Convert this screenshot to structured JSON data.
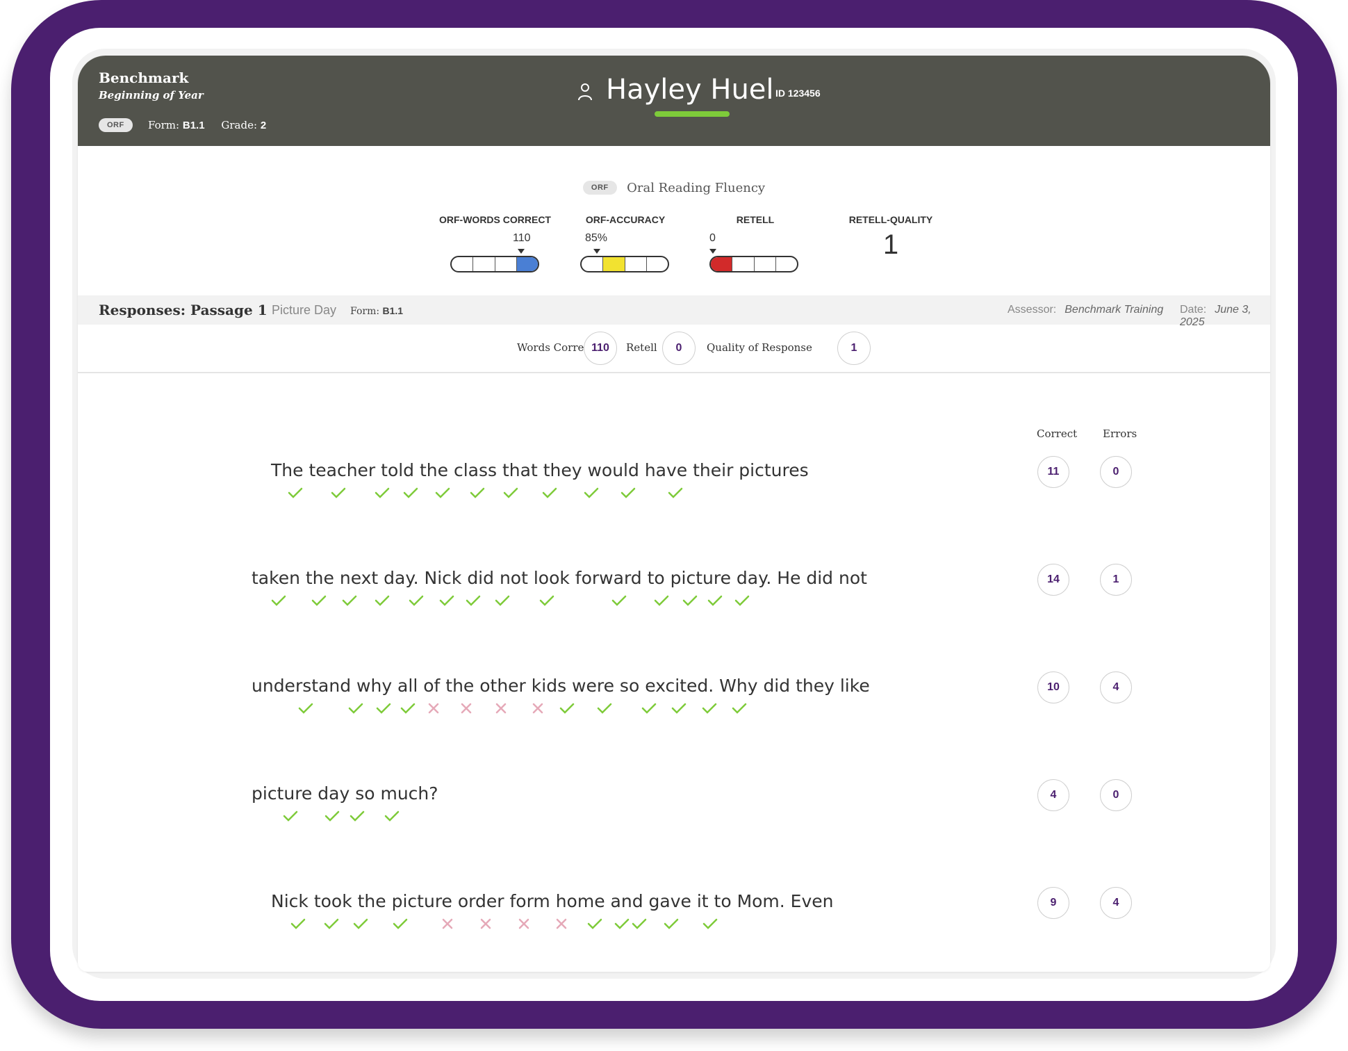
{
  "header": {
    "title": "Benchmark",
    "subtitle": "Beginning of Year",
    "badge": "ORF",
    "form_label": "Form:",
    "form_value": "B1.1",
    "grade_label": "Grade:",
    "grade_value": "2",
    "student_name": "Hayley Huel",
    "student_id": "ID 123456",
    "user_icon": "person-icon"
  },
  "scores": {
    "badge": "ORF",
    "title": "Oral Reading Fluency",
    "metrics": [
      {
        "label": "ORF-WORDS CORRECT",
        "value": "110",
        "level": 4,
        "color": "#4a7fd4"
      },
      {
        "label": "ORF-ACCURACY",
        "value": "85%",
        "level": 2,
        "color": "#f2e230"
      },
      {
        "label": "RETELL",
        "value": "0",
        "level": 1,
        "color": "#d22a2a"
      },
      {
        "label": "RETELL-QUALITY",
        "value": "1"
      }
    ]
  },
  "responses": {
    "title": "Responses: Passage",
    "passage_number": "1",
    "passage_name": "Picture Day",
    "form_label": "Form:",
    "form_value": "B1.1",
    "assessor_label": "Assessor:",
    "assessor_value": "Benchmark Training",
    "date_label": "Date:",
    "date_value": "June 3, 2025"
  },
  "summary": {
    "words_correct_label": "Words Correct",
    "words_correct_value": "110",
    "retell_label": "Retell",
    "retell_value": "0",
    "quality_label": "Quality of Response",
    "quality_value": "1"
  },
  "columns": {
    "correct": "Correct",
    "errors": "Errors"
  },
  "lines": [
    {
      "text": "The teacher told the class that they would have their pictures",
      "correct": "11",
      "errors": "0",
      "marks": "CCCCCCCCCCC"
    },
    {
      "text": "taken the next day. Nick did not look forward to picture day. He did not",
      "correct": "14",
      "errors": "1",
      "marks": "CCCCCCCCC_CCCCC"
    },
    {
      "text": "understand why all of the other kids were so excited. Why did they like",
      "correct": "10",
      "errors": "4",
      "marks": "CCCCXXXXCCCCCC"
    },
    {
      "text": "picture day so much?",
      "correct": "4",
      "errors": "0",
      "marks": "CCCC"
    },
    {
      "text": "Nick took the picture order form home and gave it to Mom. Even",
      "correct": "9",
      "errors": "4",
      "marks": "CCCCXXXXCCCCC"
    }
  ],
  "colors": {
    "check": "#7ecb3a",
    "cross": "#e5a9b8",
    "accent": "#4b1f6f",
    "header_bg": "#52534c"
  }
}
